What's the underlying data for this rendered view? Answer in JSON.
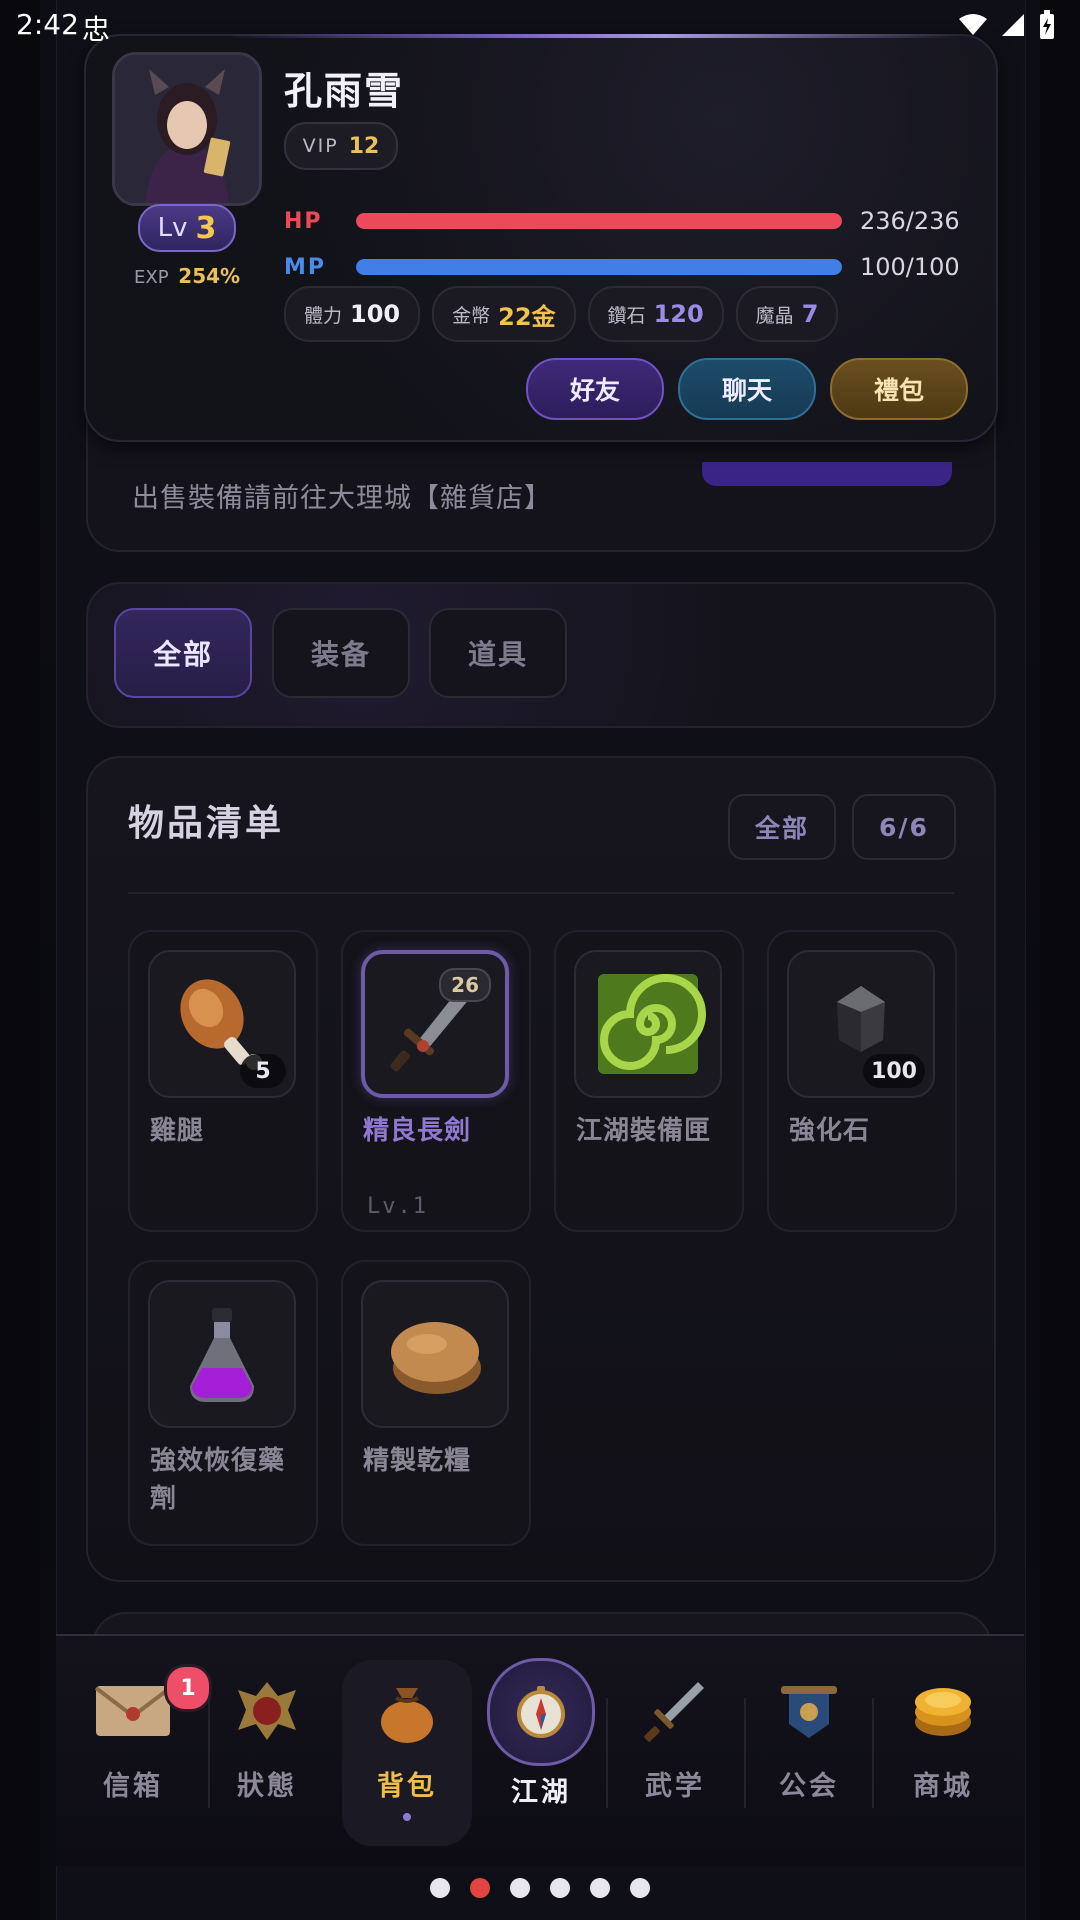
{
  "status_bar": {
    "time": "2:42",
    "bug_glyph": "忠"
  },
  "profile": {
    "name": "孔雨雪",
    "vip_label": "VIP",
    "vip_level": "12",
    "lv_label": "Lv",
    "level": "3",
    "exp_label": "EXP",
    "exp_value": "254%",
    "hp": {
      "label": "HP",
      "value": "236/236",
      "fraction": 1.0,
      "color": "#ec4a5a"
    },
    "mp": {
      "label": "MP",
      "value": "100/100",
      "fraction": 1.0,
      "color": "#3f7fe6"
    },
    "stats": [
      {
        "label": "體力",
        "value": "100",
        "color": "#f1eff6"
      },
      {
        "label": "金幣",
        "value": "22金",
        "color": "#f0c44c"
      },
      {
        "label": "鑽石",
        "value": "120",
        "color": "#9a8be8"
      },
      {
        "label": "魔晶",
        "value": "7",
        "color": "#9a8be8"
      }
    ],
    "buttons": {
      "friend": "好友",
      "chat": "聊天",
      "gift": "禮包"
    }
  },
  "notice": {
    "text": "出售裝備請前往大理城【雜貨店】"
  },
  "filter_tabs": [
    "全部",
    "装备",
    "道具"
  ],
  "inventory": {
    "title": "物品清单",
    "filter_pill": "全部",
    "count_pill": "6/6",
    "items": [
      {
        "name": "雞腿",
        "qty": "5",
        "icon": "drumstick-icon"
      },
      {
        "name": "精良長劍",
        "level_badge": "26",
        "sub": "Lv.1",
        "icon": "sword-icon",
        "selected": true
      },
      {
        "name": "江湖裝備匣",
        "icon": "swirl-box-icon"
      },
      {
        "name": "強化石",
        "qty": "100",
        "icon": "crystal-icon"
      },
      {
        "name": "強效恢復藥劑",
        "icon": "potion-icon"
      },
      {
        "name": "精製乾糧",
        "icon": "bread-icon"
      }
    ]
  },
  "bottom_nav": {
    "mail": {
      "label": "信箱",
      "badge": "1"
    },
    "status": {
      "label": "狀態"
    },
    "bag": {
      "label": "背包"
    },
    "jianghu": {
      "label": "江湖"
    },
    "martial": {
      "label": "武学"
    },
    "guild": {
      "label": "公会"
    },
    "shop": {
      "label": "商城"
    }
  },
  "pager": {
    "count": 6,
    "active_index": 1
  }
}
